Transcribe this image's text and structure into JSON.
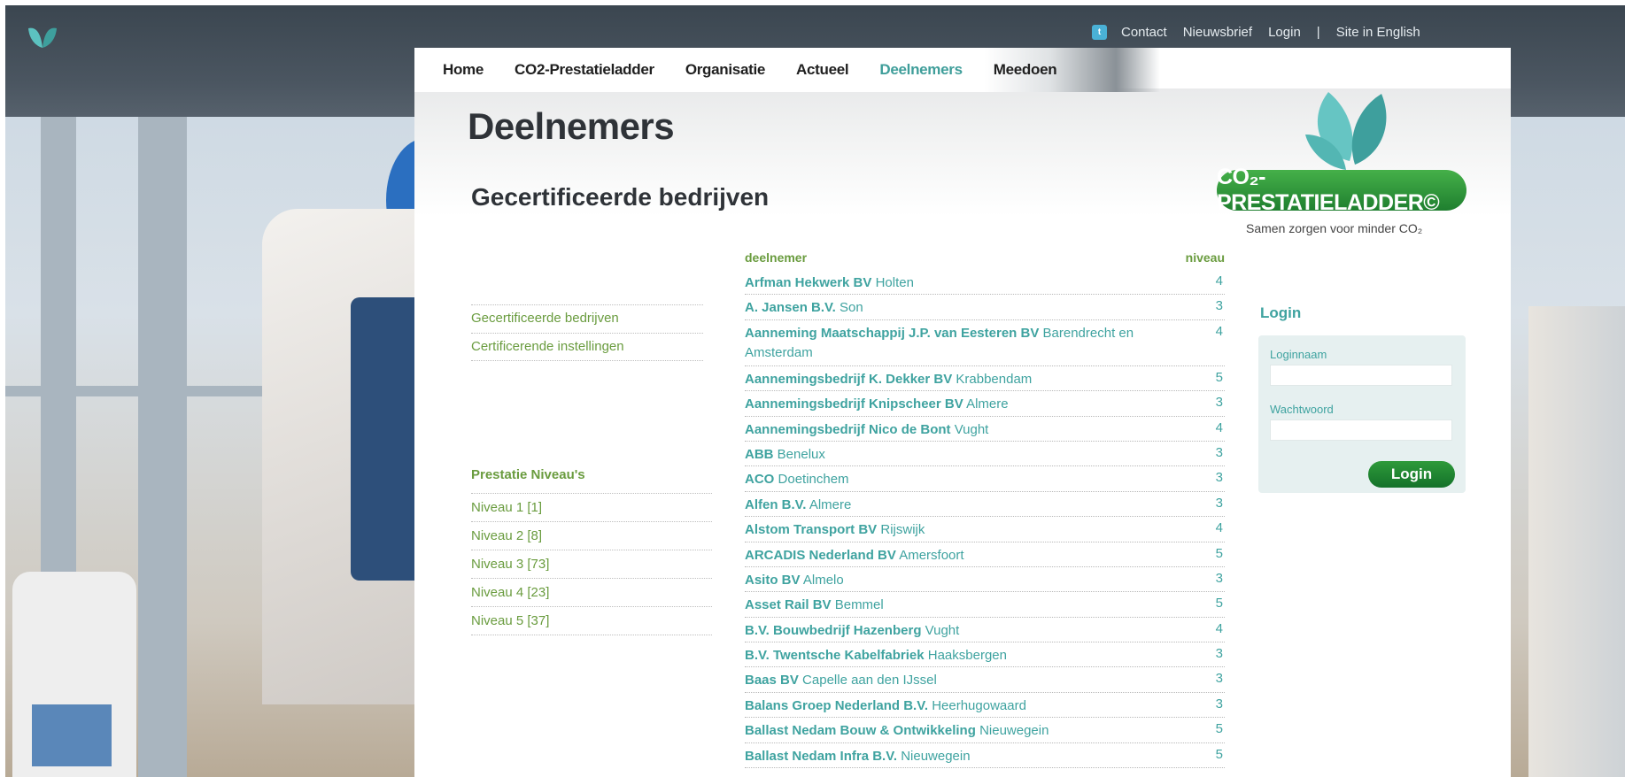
{
  "utility": {
    "twitter_icon": "twitter-icon",
    "contact": "Contact",
    "newsletter": "Nieuwsbrief",
    "login": "Login",
    "separator": "|",
    "english": "Site in English"
  },
  "nav": [
    {
      "label": "Home"
    },
    {
      "label": "CO2-Prestatieladder"
    },
    {
      "label": "Organisatie"
    },
    {
      "label": "Actueel"
    },
    {
      "label": "Deelnemers"
    },
    {
      "label": "Meedoen"
    }
  ],
  "page": {
    "title": "Deelnemers",
    "subtitle": "Gecertificeerde bedrijven"
  },
  "brand": {
    "name": "CO₂-PRESTATIELADDER©",
    "tagline": "Samen zorgen voor minder CO₂"
  },
  "sidemenu": [
    {
      "label": "Gecertificeerde bedrijven"
    },
    {
      "label": "Certificerende instellingen"
    }
  ],
  "levels": {
    "heading": "Prestatie Niveau's",
    "items": [
      {
        "label": "Niveau 1 [1]"
      },
      {
        "label": "Niveau 2 [8]"
      },
      {
        "label": "Niveau 3 [73]"
      },
      {
        "label": "Niveau 4 [23]"
      },
      {
        "label": "Niveau 5 [37]"
      }
    ]
  },
  "table": {
    "col_name": "deelnemer",
    "col_level": "niveau",
    "rows": [
      {
        "company": "Arfman Hekwerk BV",
        "city": "Holten",
        "level": "4"
      },
      {
        "company": "A. Jansen B.V.",
        "city": "Son",
        "level": "3"
      },
      {
        "company": "Aanneming Maatschappij J.P. van Eesteren BV",
        "city": "Barendrecht en Amsterdam",
        "level": "4"
      },
      {
        "company": "Aannemingsbedrijf K. Dekker BV",
        "city": "Krabbendam",
        "level": "5"
      },
      {
        "company": "Aannemingsbedrijf Knipscheer BV",
        "city": "Almere",
        "level": "3"
      },
      {
        "company": "Aannemingsbedrijf Nico de Bont",
        "city": "Vught",
        "level": "4"
      },
      {
        "company": "ABB",
        "city": "Benelux",
        "level": "3"
      },
      {
        "company": "ACO",
        "city": "Doetinchem",
        "level": "3"
      },
      {
        "company": "Alfen B.V.",
        "city": "Almere",
        "level": "3"
      },
      {
        "company": "Alstom Transport BV",
        "city": "Rijswijk",
        "level": "4"
      },
      {
        "company": "ARCADIS Nederland BV",
        "city": "Amersfoort",
        "level": "5"
      },
      {
        "company": "Asito BV",
        "city": "Almelo",
        "level": "3"
      },
      {
        "company": "Asset Rail BV",
        "city": "Bemmel",
        "level": "5"
      },
      {
        "company": "B.V. Bouwbedrijf Hazenberg",
        "city": "Vught",
        "level": "4"
      },
      {
        "company": "B.V. Twentsche Kabelfabriek",
        "city": "Haaksbergen",
        "level": "3"
      },
      {
        "company": "Baas BV",
        "city": "Capelle aan den IJssel",
        "level": "3"
      },
      {
        "company": "Balans Groep Nederland B.V.",
        "city": "Heerhugowaard",
        "level": "3"
      },
      {
        "company": "Ballast Nedam Bouw & Ontwikkeling",
        "city": "Nieuwegein",
        "level": "5"
      },
      {
        "company": "Ballast Nedam Infra B.V.",
        "city": "Nieuwegein",
        "level": "5"
      }
    ]
  },
  "login": {
    "title": "Login",
    "username_label": "Loginnaam",
    "password_label": "Wachtwoord",
    "username_value": "",
    "password_value": "",
    "button": "Login"
  },
  "colors": {
    "accent_teal": "#3fa3a0",
    "accent_green": "#6a9c3f",
    "brand_green": "#1f7f2f"
  }
}
